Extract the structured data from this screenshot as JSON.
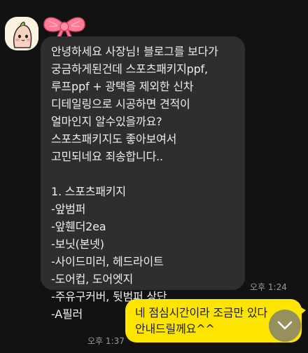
{
  "incoming": {
    "lines": [
      "안녕하세요 사장님! 블로그를 보다가",
      "궁금하게된건데 스포츠패키지ppf,",
      "루프ppf + 광택을 제외한 신차",
      "디테일링으로 시공하면 견적이",
      "얼마인지 알수있을까요?",
      "스포츠패키지도 좋아보여서",
      "고민되네요 죄송합니다..",
      "",
      "1. 스포츠패키지",
      "-앞범퍼",
      "-앞휀더2ea",
      "-보닛(본넷)",
      "-사이드미러, 헤드라이트",
      "-도어컵, 도어엣지",
      "-주유구커버, 뒷범퍼 상단",
      "-A필러"
    ],
    "time": "오후 1:24"
  },
  "outgoing": {
    "lines": [
      "네 점심시간이라 조금만 있다",
      "안내드릴께요^^"
    ],
    "time": "오후 1:37"
  },
  "icons": {
    "avatar": "profile-avatar",
    "bow": "ribbon-bow-icon",
    "scroll": "chevron-down-icon"
  },
  "colors": {
    "background": "#121212",
    "incoming_bubble": "#2e2e2e",
    "outgoing_bubble": "#fee500",
    "bow": "#ff6f8e"
  }
}
